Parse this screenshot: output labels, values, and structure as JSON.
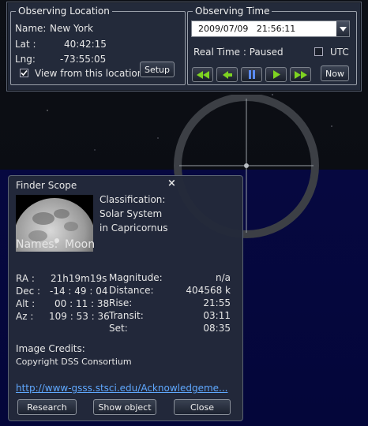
{
  "location": {
    "legend": "Observing Location",
    "name_label": "Name:",
    "name_value": "New York",
    "lat_label": "Lat :",
    "lat_value": "40:42:15",
    "lng_label": "Lng:",
    "lng_value": "-73:55:05",
    "view_checkbox_label": "View from this location",
    "view_checked": true,
    "setup_label": "Setup"
  },
  "time": {
    "legend": "Observing Time",
    "datetime_value": "2009/07/09   21:56:11",
    "real_time_status": "Real Time : Paused",
    "utc_label": "UTC",
    "utc_checked": false,
    "now_label": "Now",
    "controls": [
      "fast-rewind-icon",
      "rewind-icon",
      "pause-icon",
      "play-icon",
      "fast-forward-icon"
    ],
    "control_color": "#7ed321"
  },
  "finder": {
    "title": "Finder Scope",
    "close_glyph": "×",
    "classification_label": "Classification:",
    "classification_value": "Solar System",
    "constellation": "in Capricornus",
    "names_label": "Names:",
    "names_value": "Moon",
    "coords": {
      "ra_label": "RA :",
      "ra_value": "21h19m19s",
      "dec_label": "Dec :",
      "dec_value": "-14 : 49 : 04",
      "alt_label": "Alt :",
      "alt_value": "00 : 11 : 38",
      "az_label": "Az :",
      "az_value": "109 : 53 : 36"
    },
    "details": {
      "magnitude_label": "Magnitude:",
      "magnitude_value": "n/a",
      "distance_label": "Distance:",
      "distance_value": "404568 k",
      "rise_label": "Rise:",
      "rise_value": "21:55",
      "transit_label": "Transit:",
      "transit_value": "03:11",
      "set_label": "Set:",
      "set_value": "08:35"
    },
    "credits_label": "Image Credits:",
    "credits_value": "Copyright DSS Consortium",
    "link_text": "http://www-gsss.stsci.edu/Acknowledgeme...",
    "buttons": {
      "research": "Research",
      "show_object": "Show object",
      "close": "Close"
    }
  },
  "colors": {
    "panel": "#232a3a",
    "sky_horizon": "#04063a",
    "link": "#5fa8ff"
  }
}
